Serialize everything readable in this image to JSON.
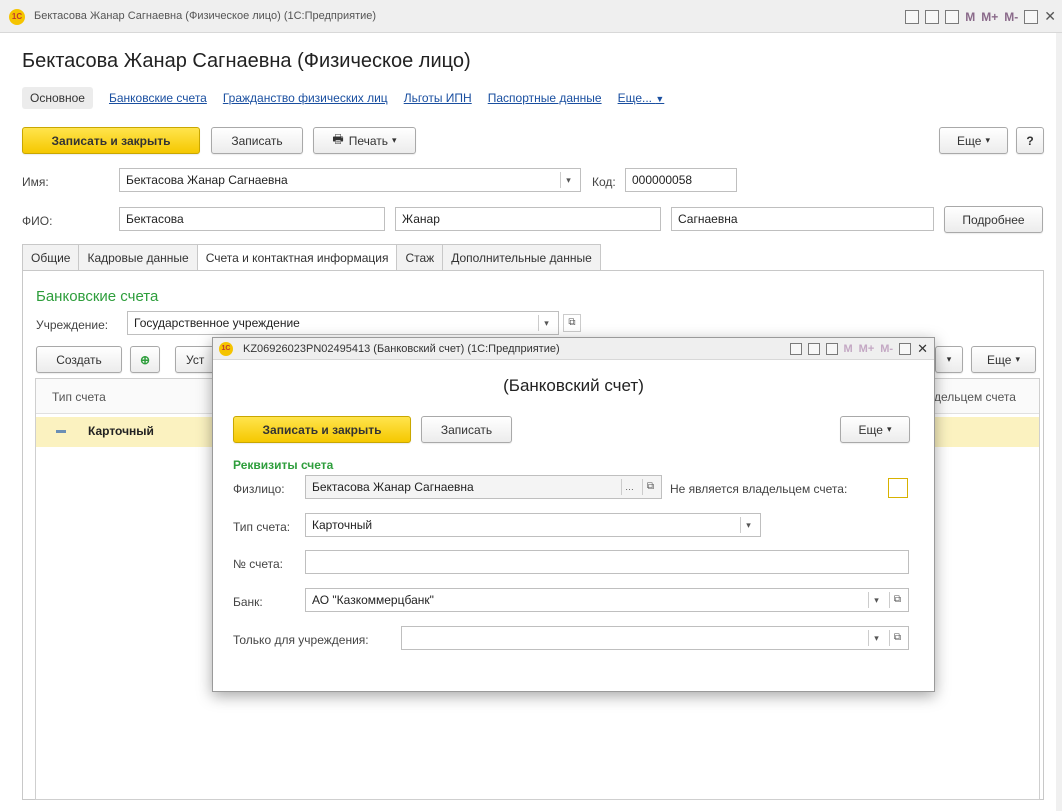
{
  "window": {
    "title": "Бектасова Жанар Сагнаевна (Физическое лицо)  (1С:Предприятие)",
    "toolbar_m": [
      "M",
      "M+",
      "M-"
    ]
  },
  "page": {
    "heading": "Бектасова Жанар Сагнаевна (Физическое лицо)",
    "nav": {
      "active": "Основное",
      "links": [
        "Банковские счета",
        "Гражданство физических лиц",
        "Льготы ИПН",
        "Паспортные данные",
        "Еще..."
      ]
    },
    "toolbar": {
      "save_close": "Записать и закрыть",
      "save": "Записать",
      "print": "Печать",
      "more": "Еще",
      "help": "?"
    },
    "fields": {
      "name_label": "Имя:",
      "name_value": "Бектасова Жанар Сагнаевна",
      "code_label": "Код:",
      "code_value": "000000058",
      "fio_label": "ФИО:",
      "surname": "Бектасова",
      "firstname": "Жанар",
      "patronymic": "Сагнаевна",
      "details_button": "Подробнее"
    },
    "tabs": [
      "Общие",
      "Кадровые данные",
      "Счета и контактная информация",
      "Стаж",
      "Дополнительные данные"
    ],
    "active_tab": "Счета и контактная информация",
    "bank_section": {
      "title": "Банковские счета",
      "institution_label": "Учреждение:",
      "institution_value": "Государственное учреждение",
      "create_button": "Создать",
      "set_button_partial": "Уст",
      "more_button": "Еще",
      "columns": [
        "Тип счета",
        "дельцем счета"
      ],
      "rows": [
        {
          "type": "Карточный"
        }
      ]
    }
  },
  "dialog": {
    "title": "KZ06926023PN02495413 (Банковский счет)  (1С:Предприятие)",
    "heading": "(Банковский счет)",
    "save_close": "Записать и закрыть",
    "save": "Записать",
    "more": "Еще",
    "section_title": "Реквизиты счета",
    "person_label": "Физлицо:",
    "person_value": "Бектасова Жанар Сагнаевна",
    "not_owner_label": "Не является владельцем счета:",
    "not_owner_checked": false,
    "acct_type_label": "Тип счета:",
    "acct_type_value": "Карточный",
    "acct_num_label": "№ счета:",
    "acct_num_value": "",
    "bank_label": "Банк:",
    "bank_value": "АО \"Казкоммерцбанк\"",
    "only_for_label": "Только для учреждения:",
    "only_for_value": ""
  },
  "colors": {
    "accent_yellow": "#f5c800",
    "link_blue": "#1a4fa0",
    "section_green": "#2e9e3c",
    "row_highlight": "#fbf2c0"
  }
}
